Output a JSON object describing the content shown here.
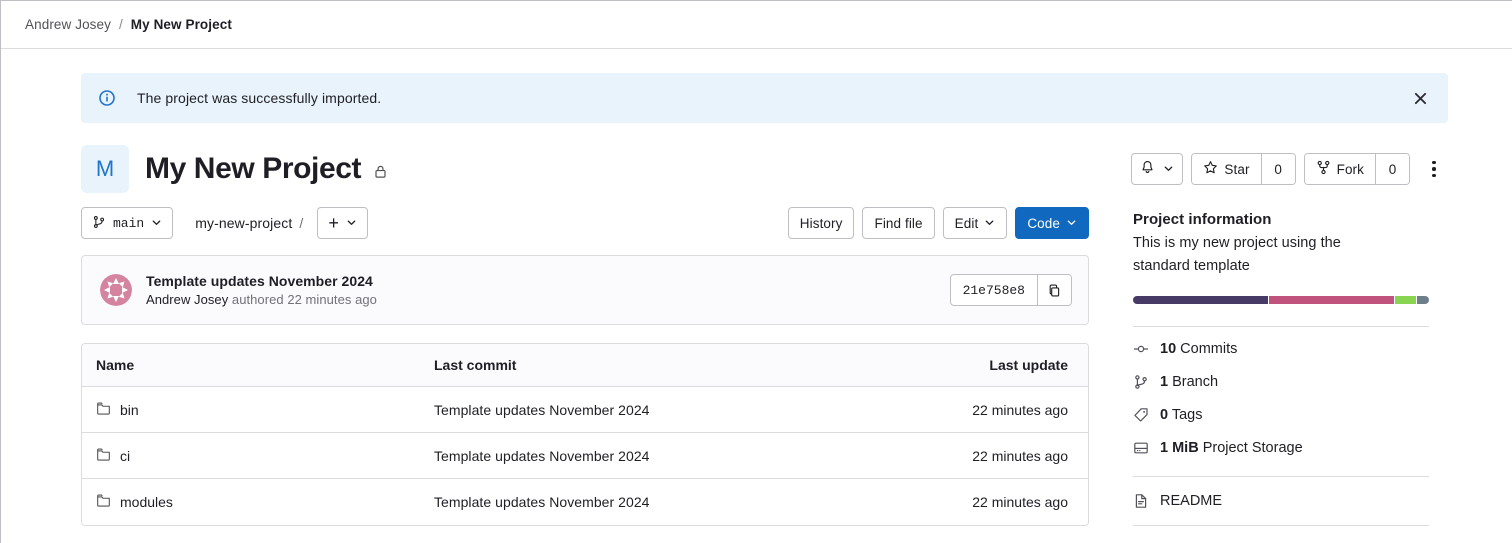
{
  "breadcrumb": {
    "owner": "Andrew Josey",
    "separator": "/",
    "current": "My New Project"
  },
  "alert": {
    "icon": "info-circle-icon",
    "message": "The project was successfully imported.",
    "close_icon": "close-icon",
    "background": "#e9f3fc",
    "icon_color": "#1f75cb"
  },
  "project_header": {
    "avatar_letter": "M",
    "avatar_bg": "#e9f3fc",
    "avatar_color": "#1f75cb",
    "title": "My New Project",
    "visibility_icon": "lock-icon",
    "notification_icon": "bell-icon",
    "notification_caret": "chevron-down-icon",
    "star": {
      "icon": "star-icon",
      "label": "Star",
      "count": "0"
    },
    "fork": {
      "icon": "fork-icon",
      "label": "Fork",
      "count": "0"
    },
    "more_actions_icon": "kebab-vertical-icon"
  },
  "repo_toolbar": {
    "branch": {
      "icon": "branch-icon",
      "name": "main",
      "caret": "chevron-down-icon"
    },
    "path": "my-new-project",
    "path_separator": "/",
    "add_button": {
      "glyph": "+",
      "caret": "chevron-down-icon"
    },
    "actions": [
      {
        "label": "History",
        "name": "history-button",
        "variant": "default",
        "caret": false
      },
      {
        "label": "Find file",
        "name": "find-file-button",
        "variant": "default",
        "caret": false
      },
      {
        "label": "Edit",
        "name": "edit-button",
        "variant": "default",
        "caret": true
      },
      {
        "label": "Code",
        "name": "code-button",
        "variant": "primary",
        "caret": true
      }
    ],
    "primary_color": "#1068bf"
  },
  "last_commit": {
    "avatar_icon": "user-identicon",
    "avatar_color": "#d4849f",
    "title": "Template updates November 2024",
    "author": "Andrew Josey",
    "action": "authored",
    "time": "22 minutes ago",
    "sha": "21e758e8",
    "copy_icon": "clipboard-icon"
  },
  "file_tree": {
    "columns": [
      "Name",
      "Last commit",
      "Last update"
    ],
    "rows": [
      {
        "icon": "folder-icon",
        "name": "bin",
        "commit": "Template updates November 2024",
        "update": "22 minutes ago"
      },
      {
        "icon": "folder-icon",
        "name": "ci",
        "commit": "Template updates November 2024",
        "update": "22 minutes ago"
      },
      {
        "icon": "folder-icon",
        "name": "modules",
        "commit": "Template updates November 2024",
        "update": "22 minutes ago"
      }
    ]
  },
  "sidebar": {
    "title": "Project information",
    "description": "This is my new project using the standard template",
    "language_bar": [
      {
        "color": "#473a66",
        "percent": 45
      },
      {
        "color": "#c0527e",
        "percent": 42
      },
      {
        "color": "#89d451",
        "percent": 7
      },
      {
        "color": "#6e7f8c",
        "percent": 4
      }
    ],
    "stats": [
      {
        "icon": "commit-icon",
        "value": "10",
        "label": "Commits",
        "name": "stat-commits"
      },
      {
        "icon": "branch-icon",
        "value": "1",
        "label": "Branch",
        "name": "stat-branches"
      },
      {
        "icon": "tag-icon",
        "value": "0",
        "label": "Tags",
        "name": "stat-tags"
      },
      {
        "icon": "storage-icon",
        "value": "1 MiB",
        "label": "Project Storage",
        "name": "stat-storage"
      }
    ],
    "readme": {
      "icon": "doc-icon",
      "label": "README"
    }
  }
}
